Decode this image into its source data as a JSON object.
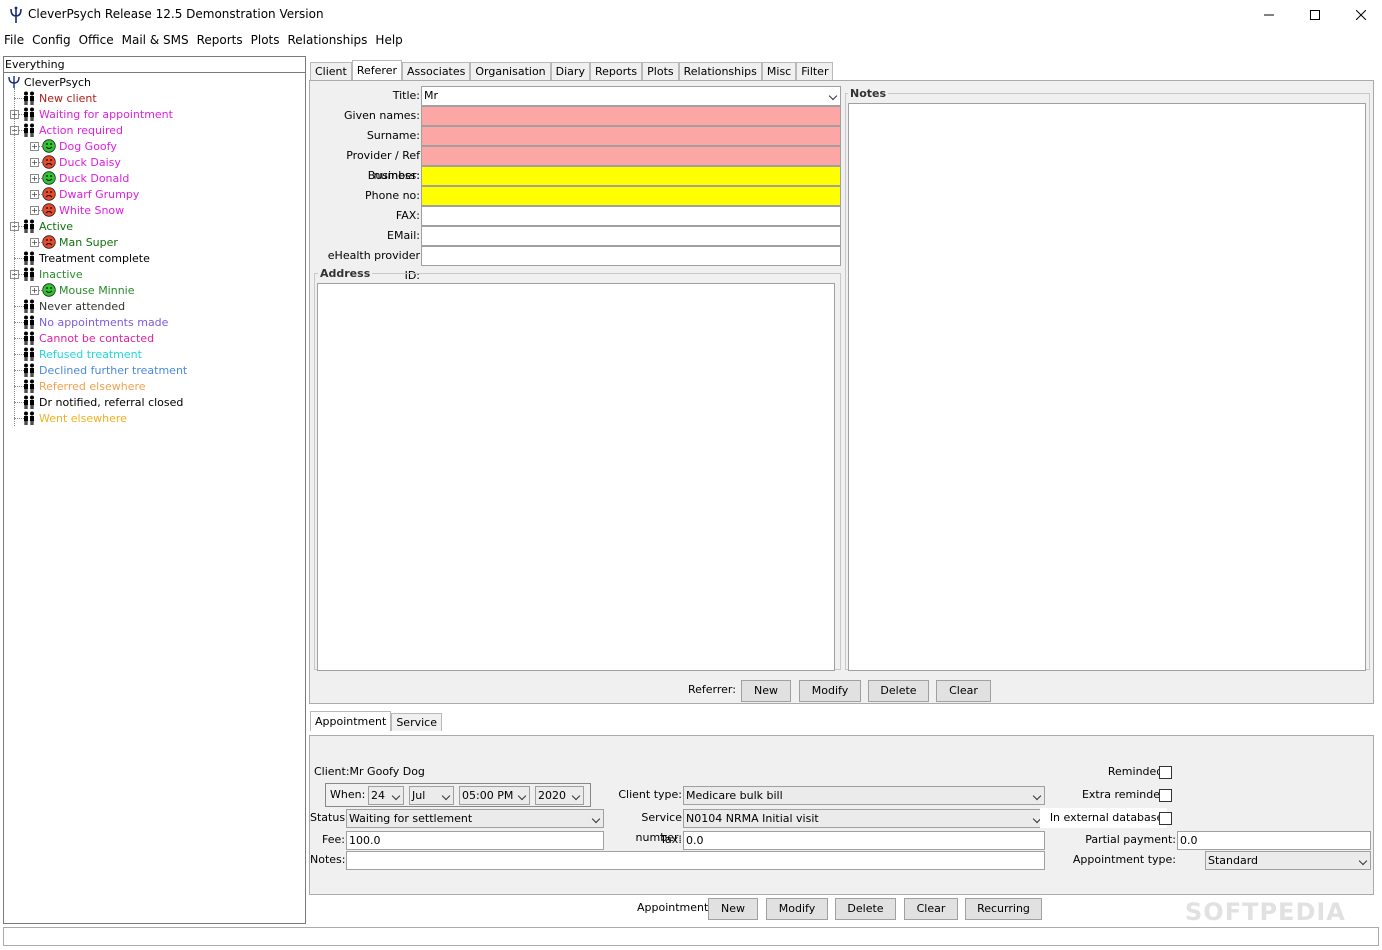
{
  "window": {
    "title": "CleverPsych Release 12.5 Demonstration Version"
  },
  "menu": [
    "File",
    "Config",
    "Office",
    "Mail & SMS",
    "Reports",
    "Plots",
    "Relationships",
    "Help"
  ],
  "tree": {
    "header": "Everything",
    "root": "CleverPsych",
    "nodes": [
      {
        "label": "New client",
        "color": "#b02020",
        "level": 1,
        "icon": "person",
        "exp": ""
      },
      {
        "label": "Waiting for appointment",
        "color": "#e020e0",
        "level": 1,
        "icon": "person",
        "exp": "+"
      },
      {
        "label": "Action required",
        "color": "#e020e0",
        "level": 1,
        "icon": "person",
        "exp": "-"
      },
      {
        "label": "Dog Goofy",
        "color": "#e020e0",
        "level": 2,
        "icon": "happy",
        "exp": "+"
      },
      {
        "label": "Duck Daisy",
        "color": "#e020e0",
        "level": 2,
        "icon": "sad",
        "exp": "+"
      },
      {
        "label": "Duck Donald",
        "color": "#e020e0",
        "level": 2,
        "icon": "happy",
        "exp": "+"
      },
      {
        "label": "Dwarf Grumpy",
        "color": "#e020e0",
        "level": 2,
        "icon": "sad",
        "exp": "+"
      },
      {
        "label": "White Snow",
        "color": "#e020e0",
        "level": 2,
        "icon": "sad",
        "exp": "+"
      },
      {
        "label": "Active",
        "color": "#107010",
        "level": 1,
        "icon": "person",
        "exp": "-"
      },
      {
        "label": "Man Super",
        "color": "#107010",
        "level": 2,
        "icon": "sad",
        "exp": "+"
      },
      {
        "label": "Treatment complete",
        "color": "#000000",
        "level": 1,
        "icon": "person",
        "exp": ""
      },
      {
        "label": "Inactive",
        "color": "#2a8a2a",
        "level": 1,
        "icon": "person",
        "exp": "-"
      },
      {
        "label": "Mouse Minnie",
        "color": "#2a8a2a",
        "level": 2,
        "icon": "happy",
        "exp": "+"
      },
      {
        "label": "Never attended",
        "color": "#333333",
        "level": 1,
        "icon": "person",
        "exp": ""
      },
      {
        "label": "No appointments made",
        "color": "#7b5be0",
        "level": 1,
        "icon": "person",
        "exp": ""
      },
      {
        "label": "Cannot be contacted",
        "color": "#e020a0",
        "level": 1,
        "icon": "person",
        "exp": ""
      },
      {
        "label": "Refused treatment",
        "color": "#20d8d8",
        "level": 1,
        "icon": "person",
        "exp": ""
      },
      {
        "label": "Declined further treatment",
        "color": "#4a8ae0",
        "level": 1,
        "icon": "person",
        "exp": ""
      },
      {
        "label": "Referred elsewhere",
        "color": "#f0a050",
        "level": 1,
        "icon": "person",
        "exp": ""
      },
      {
        "label": "Dr notified, referral closed",
        "color": "#000000",
        "level": 1,
        "icon": "person",
        "exp": ""
      },
      {
        "label": "Went elsewhere",
        "color": "#f0b020",
        "level": 1,
        "icon": "person",
        "exp": ""
      }
    ]
  },
  "top_tabs": [
    "Client",
    "Referer",
    "Associates",
    "Organisation",
    "Diary",
    "Reports",
    "Plots",
    "Relationships",
    "Misc",
    "Filter"
  ],
  "top_tabs_active": 1,
  "referer": {
    "title_label": "Title:",
    "title_value": "Mr",
    "given_label": "Given names:",
    "surname_label": "Surname:",
    "provider_label": "Provider / Ref number:",
    "business_label": "Business:",
    "phone_label": "Phone no:",
    "fax_label": "FAX:",
    "email_label": "EMail:",
    "ehealth_label": "eHealth provider ID:",
    "address_title": "Address",
    "notes_title": "Notes",
    "buttons_label": "Referrer:",
    "btn_new": "New",
    "btn_modify": "Modify",
    "btn_delete": "Delete",
    "btn_clear": "Clear"
  },
  "bottom_tabs": [
    "Appointment",
    "Service"
  ],
  "bottom_tabs_active": 0,
  "appointment": {
    "client_text": "Client:Mr Goofy Dog",
    "when_label": "When:",
    "day": "24",
    "month": "Jul",
    "time": "05:00 PM",
    "year": "2020",
    "status_label": "Status:",
    "status_value": "Waiting for settlement",
    "fee_label": "Fee:",
    "fee_value": "100.0",
    "notes_label": "Notes:",
    "client_type_label": "Client type:",
    "client_type_value": "Medicare bulk bill",
    "service_number_label": "Service number:",
    "service_number_value": "N0104 NRMA Initial visit",
    "tax_label": "Tax:",
    "tax_value": "0.0",
    "reminded_label": "Reminded:",
    "extra_reminded_label": "Extra reminded",
    "external_db_label": "In external database:",
    "partial_label": "Partial payment:",
    "partial_value": "0.0",
    "appt_type_label": "Appointment type:",
    "appt_type_value": "Standard",
    "buttons_label": "Appointment:",
    "btn_new": "New",
    "btn_modify": "Modify",
    "btn_delete": "Delete",
    "btn_clear": "Clear",
    "btn_recurring": "Recurring"
  },
  "watermark": "SOFTPEDIA"
}
